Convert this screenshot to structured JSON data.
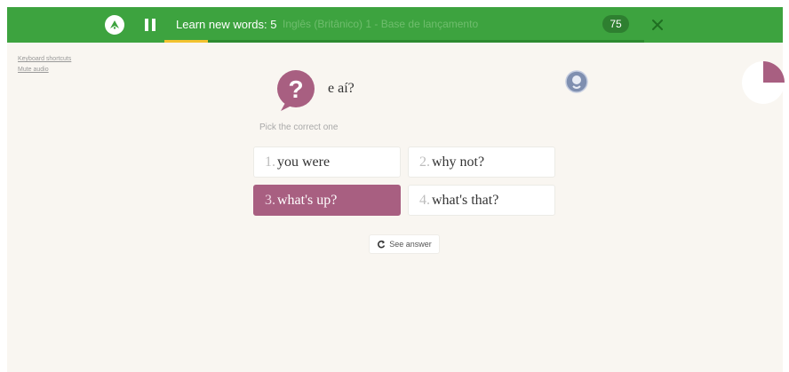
{
  "header": {
    "session_title": "Learn new words: 5",
    "course_name": "Inglês (Britânico) 1 - Base de lançamento",
    "score": "75",
    "progress_fraction": 0.09,
    "icons": {
      "logo": "memrise-logo-icon",
      "pause": "pause-icon",
      "close": "close-icon"
    }
  },
  "sidebar": {
    "keyboard_shortcuts": "Keyboard shortcuts",
    "mute_audio": "Mute audio"
  },
  "question": {
    "prompt": "e aí?",
    "instruction": "Pick the correct one",
    "icons": {
      "bubble": "question-bubble-icon",
      "audio": "audio-speaker-icon",
      "timer": "pie-timer-icon"
    }
  },
  "choices": [
    {
      "num": "1.",
      "text": "you were",
      "selected": false
    },
    {
      "num": "2.",
      "text": "why not?",
      "selected": false
    },
    {
      "num": "3.",
      "text": "what's up?",
      "selected": true
    },
    {
      "num": "4.",
      "text": "what's that?",
      "selected": false
    }
  ],
  "actions": {
    "see_answer": "See answer",
    "see_answer_icon": "refresh-icon"
  },
  "colors": {
    "header_green": "#3da33f",
    "progress_yellow": "#f2c230",
    "accent_plum": "#a85f81",
    "background": "#f9f6f1"
  }
}
